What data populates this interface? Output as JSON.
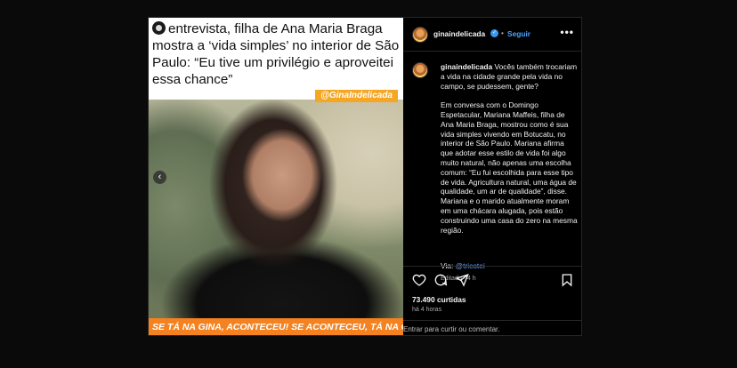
{
  "post": {
    "headline": "entrevista, filha de Ana Maria Braga mostra a ‘vida simples’ no interior de São Paulo: “Eu tive um privilégio e aproveitei essa chance”",
    "tag": "@GinaIndelicada",
    "ticker": "SE TÁ NA GINA, ACONTECEU! SE ACONTECEU, TÁ NA GINA!",
    "prev_arrow": "‹"
  },
  "header": {
    "username": "ginaindelicada",
    "separator": "•",
    "follow_label": "Seguir",
    "more": "•••"
  },
  "caption": {
    "username": "ginaindelicada",
    "body": " Vocês também trocariam a vida na cidade grande pela vida no campo, se pudessem, gente?\n\nEm conversa com o Domingo Espetacular, Mariana Maffeis, filha de Ana Maria Braga, mostrou como é sua vida simples vivendo em Botucatu, no interior de São Paulo. Mariana afirma que adotar esse estilo de vida foi algo muito natural, não apenas uma escolha comum: “Eu fui escolhida para esse tipo de vida. Agricultura natural, uma água de qualidade, um ar de qualidade”, disse. Mariana e o marido atualmente moram em uma chácara alugada, pois estão construindo uma casa do zero na mesma região.",
    "via_label": "Via:",
    "via_handle": "@tricotei",
    "edited": "Editado · 4 h"
  },
  "actions": {
    "likes": "73.490 curtidas",
    "time": "há 4 horas",
    "comment_placeholder": "Entrar para curtir ou comentar."
  },
  "colors": {
    "accent_orange": "#f58220",
    "link_blue": "#4ea0ff",
    "verified_blue": "#3897f0"
  }
}
